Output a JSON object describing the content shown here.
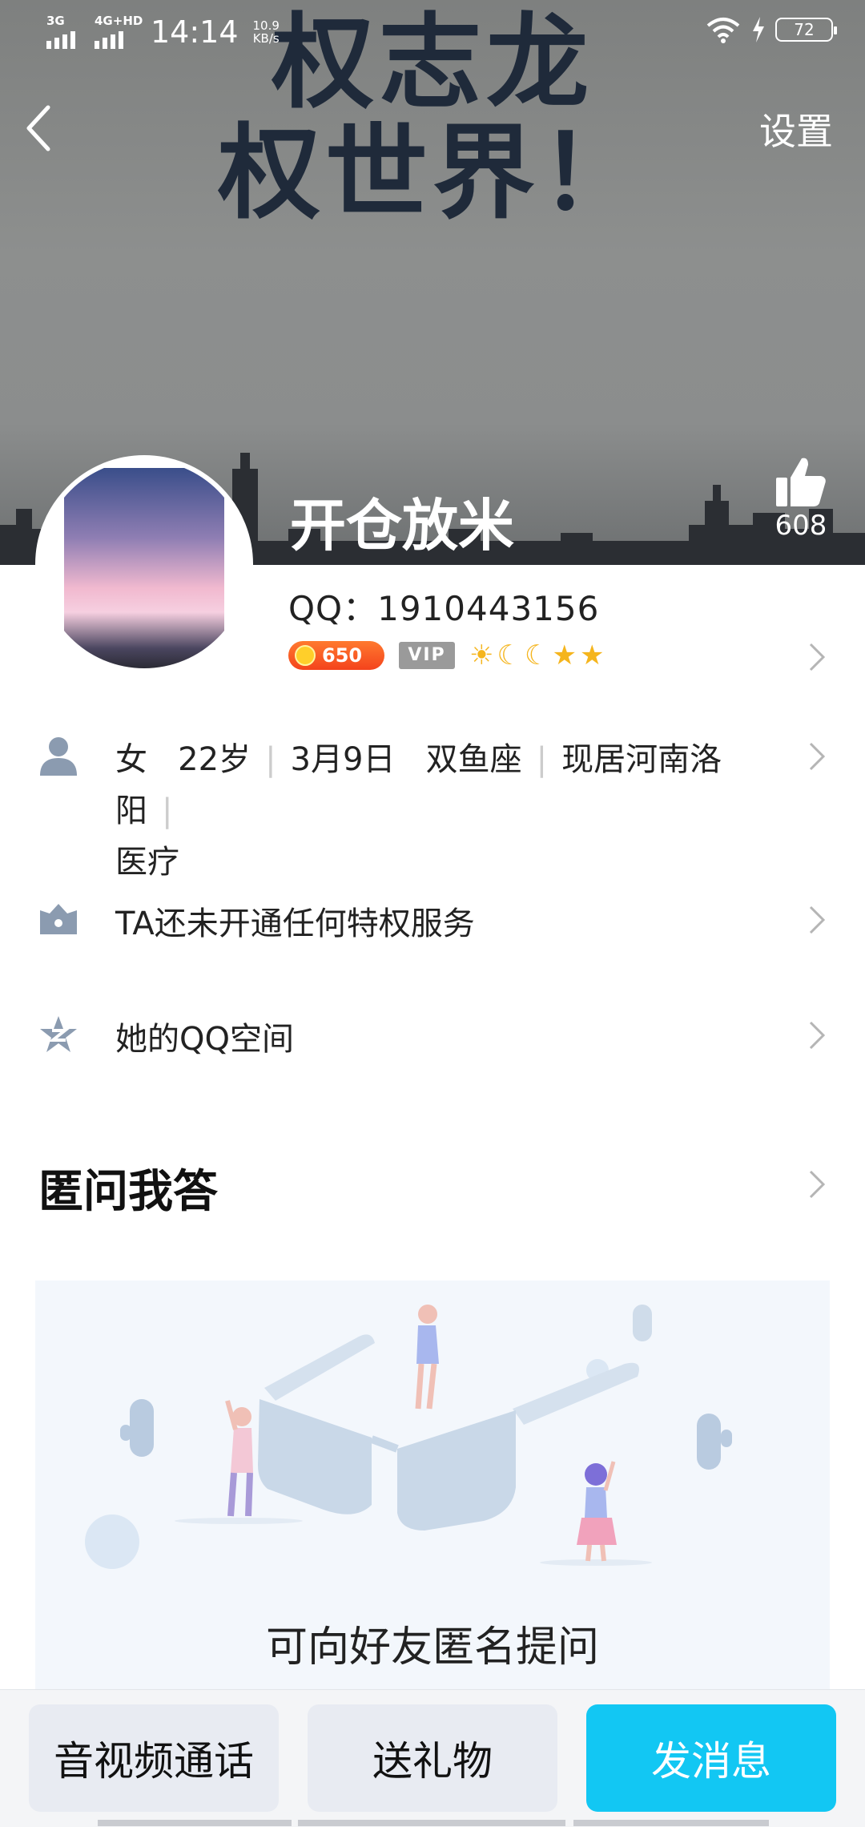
{
  "status_bar": {
    "network1": "3G",
    "network2": "4G+HD",
    "time": "14:14",
    "speed_value": "10.9",
    "speed_unit": "KB/s",
    "battery": "72"
  },
  "header": {
    "cover_text_line1": "权志龙",
    "cover_text_line2": "权世界！",
    "settings_label": "设置",
    "like_count": "608"
  },
  "profile": {
    "nickname": "开仓放米",
    "qq_number": "QQ：1910443156",
    "coin_value": "650",
    "vip_label": "VIP"
  },
  "info": {
    "gender": "女",
    "age": "22岁",
    "birthday": "3月9日",
    "constellation": "双鱼座",
    "location": "现居河南洛阳",
    "occupation": "医疗"
  },
  "list": {
    "privilege": "TA还未开通任何特权服务",
    "qzone": "她的QQ空间"
  },
  "qa": {
    "title": "匿问我答",
    "caption": "可向好友匿名提问"
  },
  "actions": {
    "call": "音视频通话",
    "gift": "送礼物",
    "message": "发消息"
  },
  "colors": {
    "primary": "#12c7f3",
    "gray_button": "#e8ebf2"
  }
}
